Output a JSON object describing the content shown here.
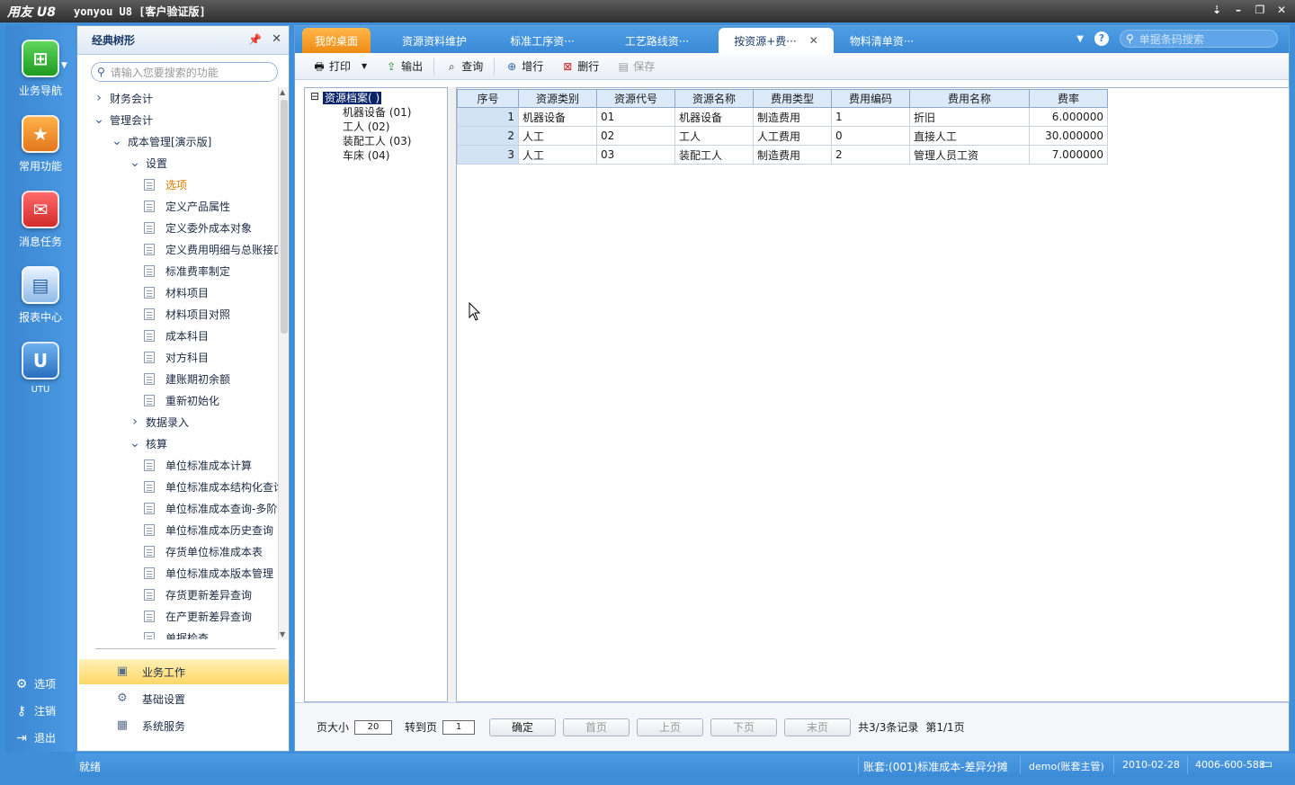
{
  "titlebar": {
    "logo": "用友 U8",
    "title": "yonyou U8 [客户验证版]"
  },
  "leftnav": {
    "items": [
      {
        "label": "业务导航",
        "icon": "business-nav-icon"
      },
      {
        "label": "常用功能",
        "icon": "star-icon"
      },
      {
        "label": "消息任务",
        "icon": "message-icon"
      },
      {
        "label": "报表中心",
        "icon": "report-icon"
      },
      {
        "label": "UTU",
        "icon": "utu-icon"
      }
    ],
    "bottom": [
      {
        "label": "选项",
        "icon": "gear-icon"
      },
      {
        "label": "注销",
        "icon": "key-icon"
      },
      {
        "label": "退出",
        "icon": "exit-icon"
      }
    ]
  },
  "sidepanel": {
    "title": "经典树形",
    "search_placeholder": "请输入您要搜索的功能",
    "tree": [
      {
        "label": "财务会计",
        "level": 0,
        "type": "collapsed"
      },
      {
        "label": "管理会计",
        "level": 0,
        "type": "expanded"
      },
      {
        "label": "成本管理[演示版]",
        "level": 1,
        "type": "expanded"
      },
      {
        "label": "设置",
        "level": 2,
        "type": "expanded"
      },
      {
        "label": "选项",
        "level": 3,
        "type": "doc",
        "highlight": true
      },
      {
        "label": "定义产品属性",
        "level": 3,
        "type": "doc"
      },
      {
        "label": "定义委外成本对象",
        "level": 3,
        "type": "doc"
      },
      {
        "label": "定义费用明细与总账接口",
        "level": 3,
        "type": "doc"
      },
      {
        "label": "标准费率制定",
        "level": 3,
        "type": "doc"
      },
      {
        "label": "材料项目",
        "level": 3,
        "type": "doc"
      },
      {
        "label": "材料项目对照",
        "level": 3,
        "type": "doc"
      },
      {
        "label": "成本科目",
        "level": 3,
        "type": "doc"
      },
      {
        "label": "对方科目",
        "level": 3,
        "type": "doc"
      },
      {
        "label": "建账期初余额",
        "level": 3,
        "type": "doc"
      },
      {
        "label": "重新初始化",
        "level": 3,
        "type": "doc"
      },
      {
        "label": "数据录入",
        "level": 2,
        "type": "collapsed"
      },
      {
        "label": "核算",
        "level": 2,
        "type": "expanded"
      },
      {
        "label": "单位标准成本计算",
        "level": 3,
        "type": "doc"
      },
      {
        "label": "单位标准成本结构化查询",
        "level": 3,
        "type": "doc"
      },
      {
        "label": "单位标准成本查询-多阶",
        "level": 3,
        "type": "doc"
      },
      {
        "label": "单位标准成本历史查询",
        "level": 3,
        "type": "doc"
      },
      {
        "label": "存货单位标准成本表",
        "level": 3,
        "type": "doc"
      },
      {
        "label": "单位标准成本版本管理",
        "level": 3,
        "type": "doc"
      },
      {
        "label": "存货更新差异查询",
        "level": 3,
        "type": "doc"
      },
      {
        "label": "在产更新差异查询",
        "level": 3,
        "type": "doc"
      },
      {
        "label": "单据检查",
        "level": 3,
        "type": "doc"
      }
    ],
    "sections": [
      {
        "label": "业务工作",
        "icon": "business-work-icon",
        "active": true
      },
      {
        "label": "基础设置",
        "icon": "settings-icon",
        "active": false
      },
      {
        "label": "系统服务",
        "icon": "system-service-icon",
        "active": false
      }
    ]
  },
  "tabs": [
    {
      "label": "我的桌面",
      "kind": "home"
    },
    {
      "label": "资源资料维护",
      "kind": "normal"
    },
    {
      "label": "标准工序资···",
      "kind": "normal"
    },
    {
      "label": "工艺路线资···",
      "kind": "normal"
    },
    {
      "label": "按资源+费···",
      "kind": "active"
    },
    {
      "label": "物料清单资···",
      "kind": "normal"
    }
  ],
  "barcode_search_placeholder": "单据条码搜索",
  "toolbar": {
    "print": "打印",
    "export": "输出",
    "query": "查询",
    "add_row": "增行",
    "delete_row": "删行",
    "save": "保存"
  },
  "resource_tree": {
    "root": "资源档案( )",
    "children": [
      "机器设备 (01)",
      "工人 (02)",
      "装配工人 (03)",
      "车床 (04)"
    ]
  },
  "grid": {
    "headers": [
      "序号",
      "资源类别",
      "资源代号",
      "资源名称",
      "费用类型",
      "费用编码",
      "费用名称",
      "费率"
    ],
    "rows": [
      [
        "1",
        "机器设备",
        "01",
        "机器设备",
        "制造费用",
        "1",
        "折旧",
        "6.000000"
      ],
      [
        "2",
        "人工",
        "02",
        "工人",
        "人工费用",
        "0",
        "直接人工",
        "30.000000"
      ],
      [
        "3",
        "人工",
        "03",
        "装配工人",
        "制造费用",
        "2",
        "管理人员工资",
        "7.000000"
      ]
    ]
  },
  "pager": {
    "page_size_label": "页大小",
    "page_size": "20",
    "goto_label": "转到页",
    "goto_page": "1",
    "confirm": "确定",
    "first": "首页",
    "prev": "上页",
    "next": "下页",
    "last": "末页",
    "total": "共3/3条记录",
    "page_info": "第1/1页"
  },
  "statusbar": {
    "state": "就绪",
    "account": "账套:(001)标准成本-差异分摊",
    "user": "demo(账套主管)",
    "date": "2010-02-28",
    "phone": "4006-600-588"
  },
  "colors": {
    "accent": "#3f8ed8",
    "home_tab": "#ee8a12",
    "selection": "#0a246a",
    "highlight_item": "#e07b00"
  }
}
